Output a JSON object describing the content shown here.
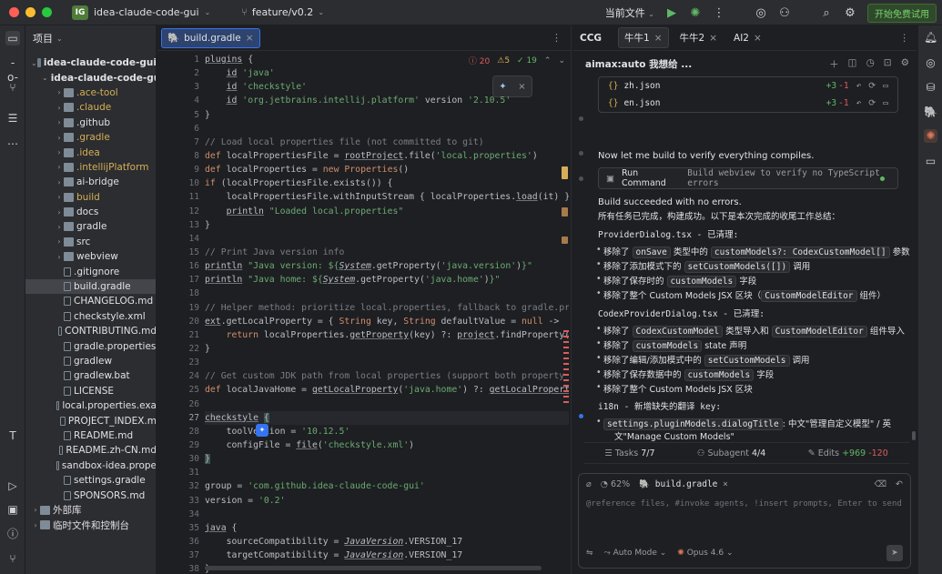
{
  "titlebar": {
    "project_badge": "IG",
    "project": "idea-claude-code-gui",
    "branch": "feature/v0.2",
    "run_config": "当前文件",
    "trial": "开始免费试用"
  },
  "project_panel": {
    "title": "项目",
    "items": [
      {
        "label": "idea-claude-code-gui",
        "depth": 0,
        "type": "root",
        "open": true
      },
      {
        "label": "idea-claude-code-gui",
        "depth": 1,
        "type": "root",
        "open": true
      },
      {
        "label": ".ace-tool",
        "depth": 2,
        "type": "folder",
        "color": "#d6ae58"
      },
      {
        "label": ".claude",
        "depth": 2,
        "type": "folder",
        "color": "#d6ae58"
      },
      {
        "label": ".github",
        "depth": 2,
        "type": "folder",
        "color": "#dfe1e5"
      },
      {
        "label": ".gradle",
        "depth": 2,
        "type": "folder",
        "color": "#d6ae58"
      },
      {
        "label": ".idea",
        "depth": 2,
        "type": "folder",
        "color": "#d6ae58"
      },
      {
        "label": ".intellijPlatform",
        "depth": 2,
        "type": "folder",
        "color": "#d6ae58"
      },
      {
        "label": "ai-bridge",
        "depth": 2,
        "type": "folder",
        "color": "#dfe1e5"
      },
      {
        "label": "build",
        "depth": 2,
        "type": "folder",
        "color": "#d6ae58"
      },
      {
        "label": "docs",
        "depth": 2,
        "type": "folder",
        "color": "#dfe1e5"
      },
      {
        "label": "gradle",
        "depth": 2,
        "type": "folder",
        "color": "#dfe1e5"
      },
      {
        "label": "src",
        "depth": 2,
        "type": "folder",
        "color": "#dfe1e5"
      },
      {
        "label": "webview",
        "depth": 2,
        "type": "folder",
        "color": "#dfe1e5"
      },
      {
        "label": ".gitignore",
        "depth": 2,
        "type": "file",
        "color": "#dfe1e5"
      },
      {
        "label": "build.gradle",
        "depth": 2,
        "type": "file",
        "color": "#dfe1e5",
        "selected": true
      },
      {
        "label": "CHANGELOG.md",
        "depth": 2,
        "type": "file",
        "color": "#dfe1e5"
      },
      {
        "label": "checkstyle.xml",
        "depth": 2,
        "type": "file",
        "color": "#dfe1e5"
      },
      {
        "label": "CONTRIBUTING.md",
        "depth": 2,
        "type": "file",
        "color": "#dfe1e5"
      },
      {
        "label": "gradle.properties",
        "depth": 2,
        "type": "file",
        "color": "#dfe1e5"
      },
      {
        "label": "gradlew",
        "depth": 2,
        "type": "file",
        "color": "#dfe1e5"
      },
      {
        "label": "gradlew.bat",
        "depth": 2,
        "type": "file",
        "color": "#dfe1e5"
      },
      {
        "label": "LICENSE",
        "depth": 2,
        "type": "file",
        "color": "#dfe1e5"
      },
      {
        "label": "local.properties.exa",
        "depth": 2,
        "type": "file",
        "color": "#dfe1e5"
      },
      {
        "label": "PROJECT_INDEX.m",
        "depth": 2,
        "type": "file",
        "color": "#dfe1e5"
      },
      {
        "label": "README.md",
        "depth": 2,
        "type": "file",
        "color": "#dfe1e5"
      },
      {
        "label": "README.zh-CN.md",
        "depth": 2,
        "type": "file",
        "color": "#dfe1e5"
      },
      {
        "label": "sandbox-idea.prope",
        "depth": 2,
        "type": "file",
        "color": "#dfe1e5"
      },
      {
        "label": "settings.gradle",
        "depth": 2,
        "type": "file",
        "color": "#dfe1e5"
      },
      {
        "label": "SPONSORS.md",
        "depth": 2,
        "type": "file",
        "color": "#dfe1e5"
      },
      {
        "label": "外部库",
        "depth": 0,
        "type": "folder",
        "color": "#dfe1e5"
      },
      {
        "label": "临时文件和控制台",
        "depth": 0,
        "type": "folder",
        "color": "#dfe1e5"
      }
    ]
  },
  "editor": {
    "tab": "build.gradle",
    "errors": "20",
    "warnings": "5",
    "ok": "19",
    "current_line": 27,
    "line_numbers": [
      "1",
      "2",
      "3",
      "4",
      "5",
      "6",
      "7",
      "8",
      "9",
      "10",
      "11",
      "12",
      "13",
      "14",
      "15",
      "16",
      "17",
      "18",
      "19",
      "20",
      "21",
      "22",
      "23",
      "24",
      "25",
      "26",
      "27",
      "28",
      "29",
      "30",
      "31",
      "32",
      "33",
      "34",
      "35",
      "36",
      "37",
      "38"
    ]
  },
  "assistant": {
    "tabs": [
      "CCG",
      "牛牛1",
      "牛牛2",
      "AI2"
    ],
    "session": "aimax:auto 我想给 ...",
    "files": [
      {
        "name": "zh.json",
        "add": "+3",
        "del": "-1"
      },
      {
        "name": "en.json",
        "add": "+3",
        "del": "-1"
      }
    ],
    "msg1": "Now let me build to verify everything compiles.",
    "run_label": "Run Command",
    "run_desc": "Build webview to verify no TypeScript errors",
    "msg2": "Build succeeded with no errors.",
    "msg3": "所有任务已完成，构建成功。以下是本次完成的收尾工作总结：",
    "h1": "ProviderDialog.tsx - 已清理:",
    "h2": "CodexProviderDialog.tsx - 已清理:",
    "h3": "i18n - 新增缺失的翻译 key:",
    "stats": {
      "tasks": "Tasks",
      "tasks_n": "7/7",
      "sub": "Subagent",
      "sub_n": "4/4",
      "edits": "Edits",
      "edits_add": "+969",
      "edits_del": "-120"
    },
    "input": {
      "percent": "62%",
      "file": "build.gradle",
      "placeholder": "@reference files, #invoke agents, !insert prompts, Enter to send",
      "mode": "Auto Mode",
      "model": "Opus 4.6"
    }
  }
}
